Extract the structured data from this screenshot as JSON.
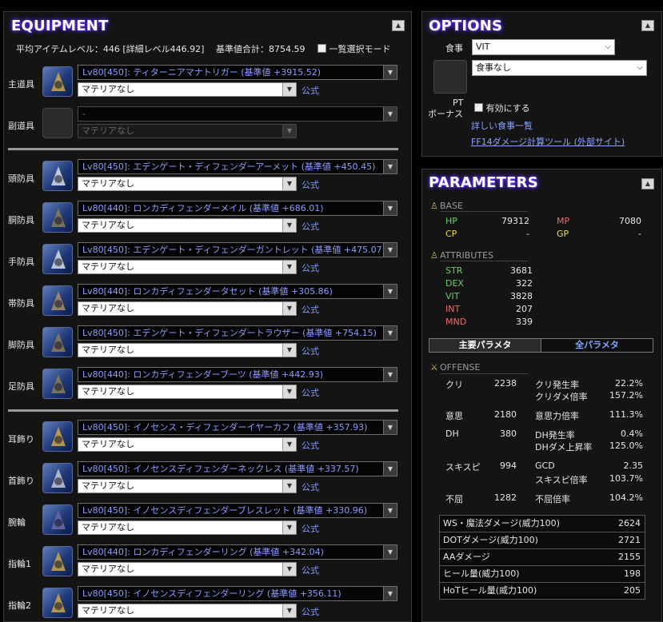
{
  "equipment": {
    "title": "EQUIPMENT",
    "avg_item_level": "平均アイテムレベル：446 [詳細レベル446.92]",
    "base_total": "基準値合計：8754.59",
    "bulk_select_label": "一覧選択モード",
    "official_label": "公式",
    "materia_none": "マテリアなし",
    "slots": [
      {
        "label": "主道具",
        "item": "Lv80[450]: ティターニアマナトリガー (基準値 +3915.52)",
        "materia": "マテリアなし",
        "icon": "book-weapon-icon"
      },
      {
        "label": "副道具",
        "item": "-",
        "materia": "マテリアなし",
        "icon": "empty-slot-icon"
      },
      {
        "label": "頭防具",
        "item": "Lv80[450]: エデンゲート・ディフェンダーアーメット (基準値 +450.45)",
        "materia": "マテリアなし",
        "icon": "helmet-icon"
      },
      {
        "label": "胴防具",
        "item": "Lv80[440]: ロンカディフェンダーメイル (基準値 +686.01)",
        "materia": "マテリアなし",
        "icon": "body-armor-icon"
      },
      {
        "label": "手防具",
        "item": "Lv80[450]: エデンゲート・ディフェンダーガントレット (基準値 +475.07)",
        "materia": "マテリアなし",
        "icon": "gauntlet-icon"
      },
      {
        "label": "帯防具",
        "item": "Lv80[440]: ロンカディフェンダータセット (基準値 +305.86)",
        "materia": "マテリアなし",
        "icon": "belt-icon"
      },
      {
        "label": "脚防具",
        "item": "Lv80[450]: エデンゲート・ディフェンダートラウザー (基準値 +754.15)",
        "materia": "マテリアなし",
        "icon": "legs-icon"
      },
      {
        "label": "足防具",
        "item": "Lv80[440]: ロンカディフェンダーブーツ (基準値 +442.93)",
        "materia": "マテリアなし",
        "icon": "boots-icon"
      },
      {
        "label": "耳飾り",
        "item": "Lv80[450]: イノセンス・ディフェンダーイヤーカフ (基準値 +357.93)",
        "materia": "マテリアなし",
        "icon": "earring-icon"
      },
      {
        "label": "首飾り",
        "item": "Lv80[450]: イノセンスディフェンダーネックレス (基準値 +337.57)",
        "materia": "マテリアなし",
        "icon": "necklace-icon"
      },
      {
        "label": "腕輪",
        "item": "Lv80[450]: イノセンスディフェンダーブレスレット (基準値 +330.96)",
        "materia": "マテリアなし",
        "icon": "bracelet-icon"
      },
      {
        "label": "指輪1",
        "item": "Lv80[440]: ロンカディフェンダーリング (基準値 +342.04)",
        "materia": "マテリアなし",
        "icon": "ring-icon"
      },
      {
        "label": "指輪2",
        "item": "Lv80[450]: イノセンスディフェンダーリング (基準値 +356.11)",
        "materia": "マテリアなし",
        "icon": "ring-icon"
      }
    ]
  },
  "options": {
    "title": "OPTIONS",
    "food_label": "食事",
    "food_stat": "VIT",
    "food_item": "食事なし",
    "pt_bonus_label_1": "PT",
    "pt_bonus_label_2": "ボーナス",
    "pt_enable_label": "有効にする",
    "food_list_link": "詳しい食事一覧",
    "calc_tool_link": "FF14ダメージ計算ツール (外部サイト)"
  },
  "parameters": {
    "title": "PARAMETERS",
    "base_head": "BASE",
    "attributes_head": "ATTRIBUTES",
    "offense_head": "OFFENSE",
    "base": {
      "hp_label": "HP",
      "hp": "79312",
      "mp_label": "MP",
      "mp": "7080",
      "cp_label": "CP",
      "cp": "-",
      "gp_label": "GP",
      "gp": "-"
    },
    "attributes": [
      {
        "label": "STR",
        "value": "3681",
        "color": "#66cc66"
      },
      {
        "label": "DEX",
        "value": "322",
        "color": "#66cc66"
      },
      {
        "label": "VIT",
        "value": "3828",
        "color": "#66cc66"
      },
      {
        "label": "INT",
        "value": "207",
        "color": "#ee6a6a"
      },
      {
        "label": "MND",
        "value": "339",
        "color": "#ee6a6a"
      }
    ],
    "tabs": {
      "main": "主要パラメタ",
      "all": "全パラメタ"
    },
    "offense": {
      "crit_label": "クリ",
      "crit": "2238",
      "crit_rate_label": "クリ発生率",
      "crit_rate": "22.2%",
      "crit_dmg_label": "クリダメ倍率",
      "crit_dmg": "157.2%",
      "det_label": "意思",
      "det": "2180",
      "det_mult_label": "意思力倍率",
      "det_mult": "111.3%",
      "dh_label": "DH",
      "dh": "380",
      "dh_rate_label": "DH発生率",
      "dh_rate": "0.4%",
      "dh_dmg_label": "DHダメ上昇率",
      "dh_dmg": "125.0%",
      "sks_label": "スキスピ",
      "sks": "994",
      "gcd_label": "GCD",
      "gcd": "2.35",
      "sks_mult_label": "スキスピ倍率",
      "sks_mult": "103.7%",
      "ten_label": "不屈",
      "ten": "1282",
      "ten_mult_label": "不屈倍率",
      "ten_mult": "104.2%"
    },
    "damage": [
      {
        "label": "WS・魔法ダメージ(威力100)",
        "value": "2624"
      },
      {
        "label": "DOTダメージ(威力100)",
        "value": "2721"
      },
      {
        "label": "AAダメージ",
        "value": "2155"
      },
      {
        "label": "ヒール量(威力100)",
        "value": "198"
      },
      {
        "label": "HoTヒール量(威力100)",
        "value": "205"
      }
    ]
  },
  "colors": {
    "title_glow": "#6a3cff",
    "link": "#8aa4ff",
    "item_text": "#8c9cff",
    "hp_green": "#66cc66",
    "mp_red": "#ee6a6a",
    "cp_yellow": "#e8d85a",
    "tab_active_bg": "#2a2a2a",
    "tab_inactive_text": "#7fa8ff"
  }
}
